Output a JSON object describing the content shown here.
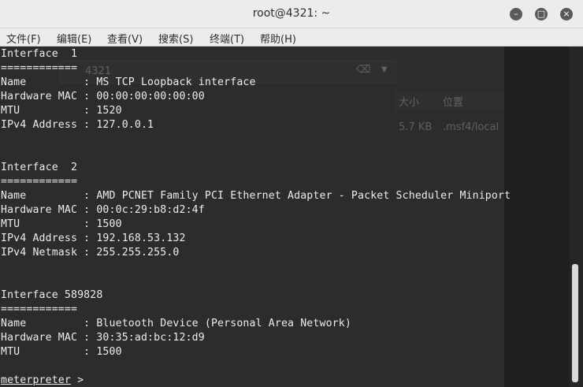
{
  "window": {
    "title": "root@4321: ~",
    "minimize_glyph": "–",
    "maximize_glyph": "□",
    "close_glyph": "×"
  },
  "menu": [
    {
      "label": "文件(F)"
    },
    {
      "label": "编辑(E)"
    },
    {
      "label": "查看(V)"
    },
    {
      "label": "搜索(S)"
    },
    {
      "label": "终端(T)"
    },
    {
      "label": "帮助(H)"
    }
  ],
  "background_window": {
    "path_fragment": "4321",
    "size_header": "大小",
    "location_header": "位置",
    "file_size": "5.7 KB",
    "file_location": ".msf4/local"
  },
  "terminal": {
    "lines": [
      "Interface  1",
      "============",
      "Name         : MS TCP Loopback interface",
      "Hardware MAC : 00:00:00:00:00:00",
      "MTU          : 1520",
      "IPv4 Address : 127.0.0.1",
      "",
      "",
      "Interface  2",
      "============",
      "Name         : AMD PCNET Family PCI Ethernet Adapter - Packet Scheduler Miniport",
      "Hardware MAC : 00:0c:29:b8:d2:4f",
      "MTU          : 1500",
      "IPv4 Address : 192.168.53.132",
      "IPv4 Netmask : 255.255.255.0",
      "",
      "",
      "Interface 589828",
      "============",
      "Name         : Bluetooth Device (Personal Area Network)",
      "Hardware MAC : 30:35:ad:bc:12:d9",
      "MTU          : 1500",
      ""
    ],
    "prompt": "meterpreter",
    "prompt_suffix": " >"
  },
  "colors": {
    "terminal_bg": "#2c2c2c",
    "terminal_fg": "#ececec",
    "titlebar_bg": "#ececec",
    "scroll_thumb": "#d9d9d9"
  }
}
